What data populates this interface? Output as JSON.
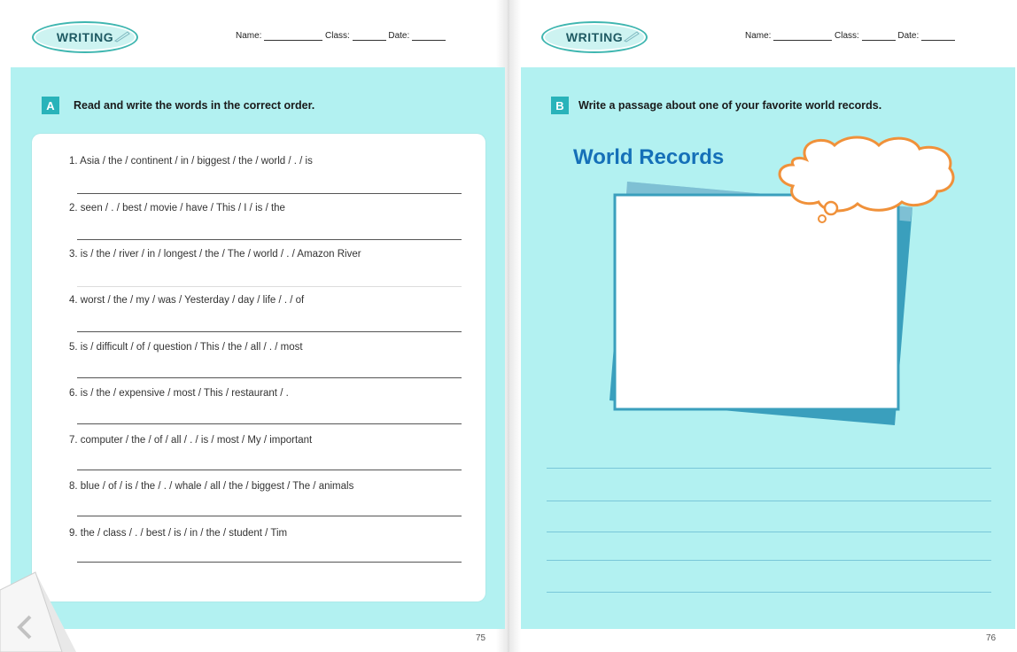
{
  "left_page": {
    "badge": "WRITING",
    "name_label": "Name:",
    "class_label": "Class:",
    "date_label": "Date:",
    "section": {
      "letter": "A",
      "instruction": "Read and write the words in the correct order."
    },
    "questions": [
      "1. Asia / the / continent / in / biggest / the / world / . / is",
      "2. seen / . / best / movie / have / This / I / is / the",
      "3. is / the / river / in / longest / the / The / world / . / Amazon River",
      "4. worst / the / my / was / Yesterday / day / life / . / of",
      "5. is / difficult / of / question / This / the / all / . / most",
      "6. is / the / expensive / most / This / restaurant / .",
      "7. computer / the / of / all / . / is / most / My / important",
      "8. blue / of / is / the / . / whale / all / the / biggest / The / animals",
      "9. the / class / . / best / is / in / the / student / Tim"
    ],
    "page_number": "75"
  },
  "right_page": {
    "badge": "WRITING",
    "name_label": "Name:",
    "class_label": "Class:",
    "date_label": "Date:",
    "section": {
      "letter": "B",
      "instruction": "Write a passage about  one of your favorite world records."
    },
    "title": "World Records",
    "page_number": "76"
  },
  "colors": {
    "panel": "#b2f1f1",
    "accent": "#29b3ba",
    "title_blue": "#1570b8",
    "cloud_orange": "#f0913a"
  }
}
